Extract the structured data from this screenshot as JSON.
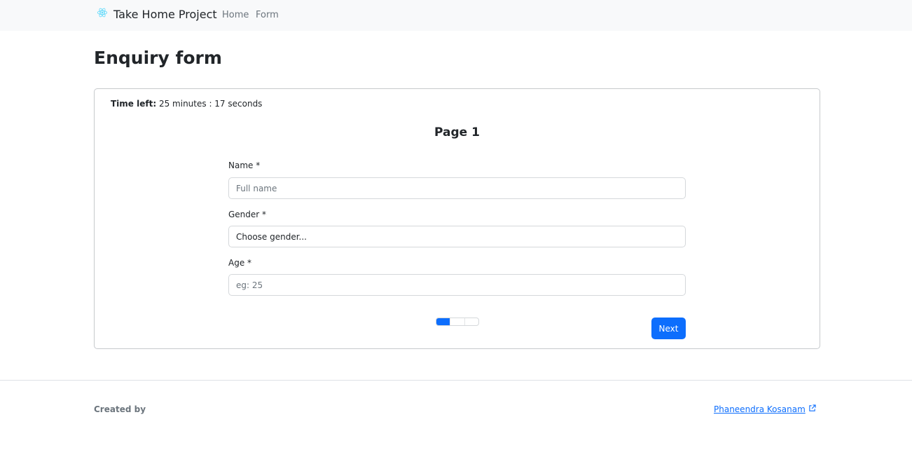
{
  "navbar": {
    "brand": "Take Home Project",
    "links": [
      "Home",
      "Form"
    ]
  },
  "page_title": "Enquiry form",
  "timer": {
    "label": "Time left:",
    "value": "25 minutes : 17 seconds"
  },
  "form": {
    "page_heading": "Page 1",
    "fields": {
      "name": {
        "label": "Name *",
        "placeholder": "Full name",
        "value": ""
      },
      "gender": {
        "label": "Gender *",
        "selected": "Choose gender..."
      },
      "age": {
        "label": "Age *",
        "placeholder": "eg: 25",
        "value": ""
      }
    },
    "progress": {
      "total_steps": 3,
      "current_step": 1
    },
    "next_label": "Next"
  },
  "footer": {
    "created_by": "Created by",
    "author": "Phaneendra Kosanam"
  },
  "colors": {
    "accent": "#0d6efd",
    "navbar_bg": "#f8f9fa",
    "react_logo": "#61dafb"
  },
  "icons": {
    "brand": "react-logo-icon",
    "author_link": "external-link-icon"
  }
}
